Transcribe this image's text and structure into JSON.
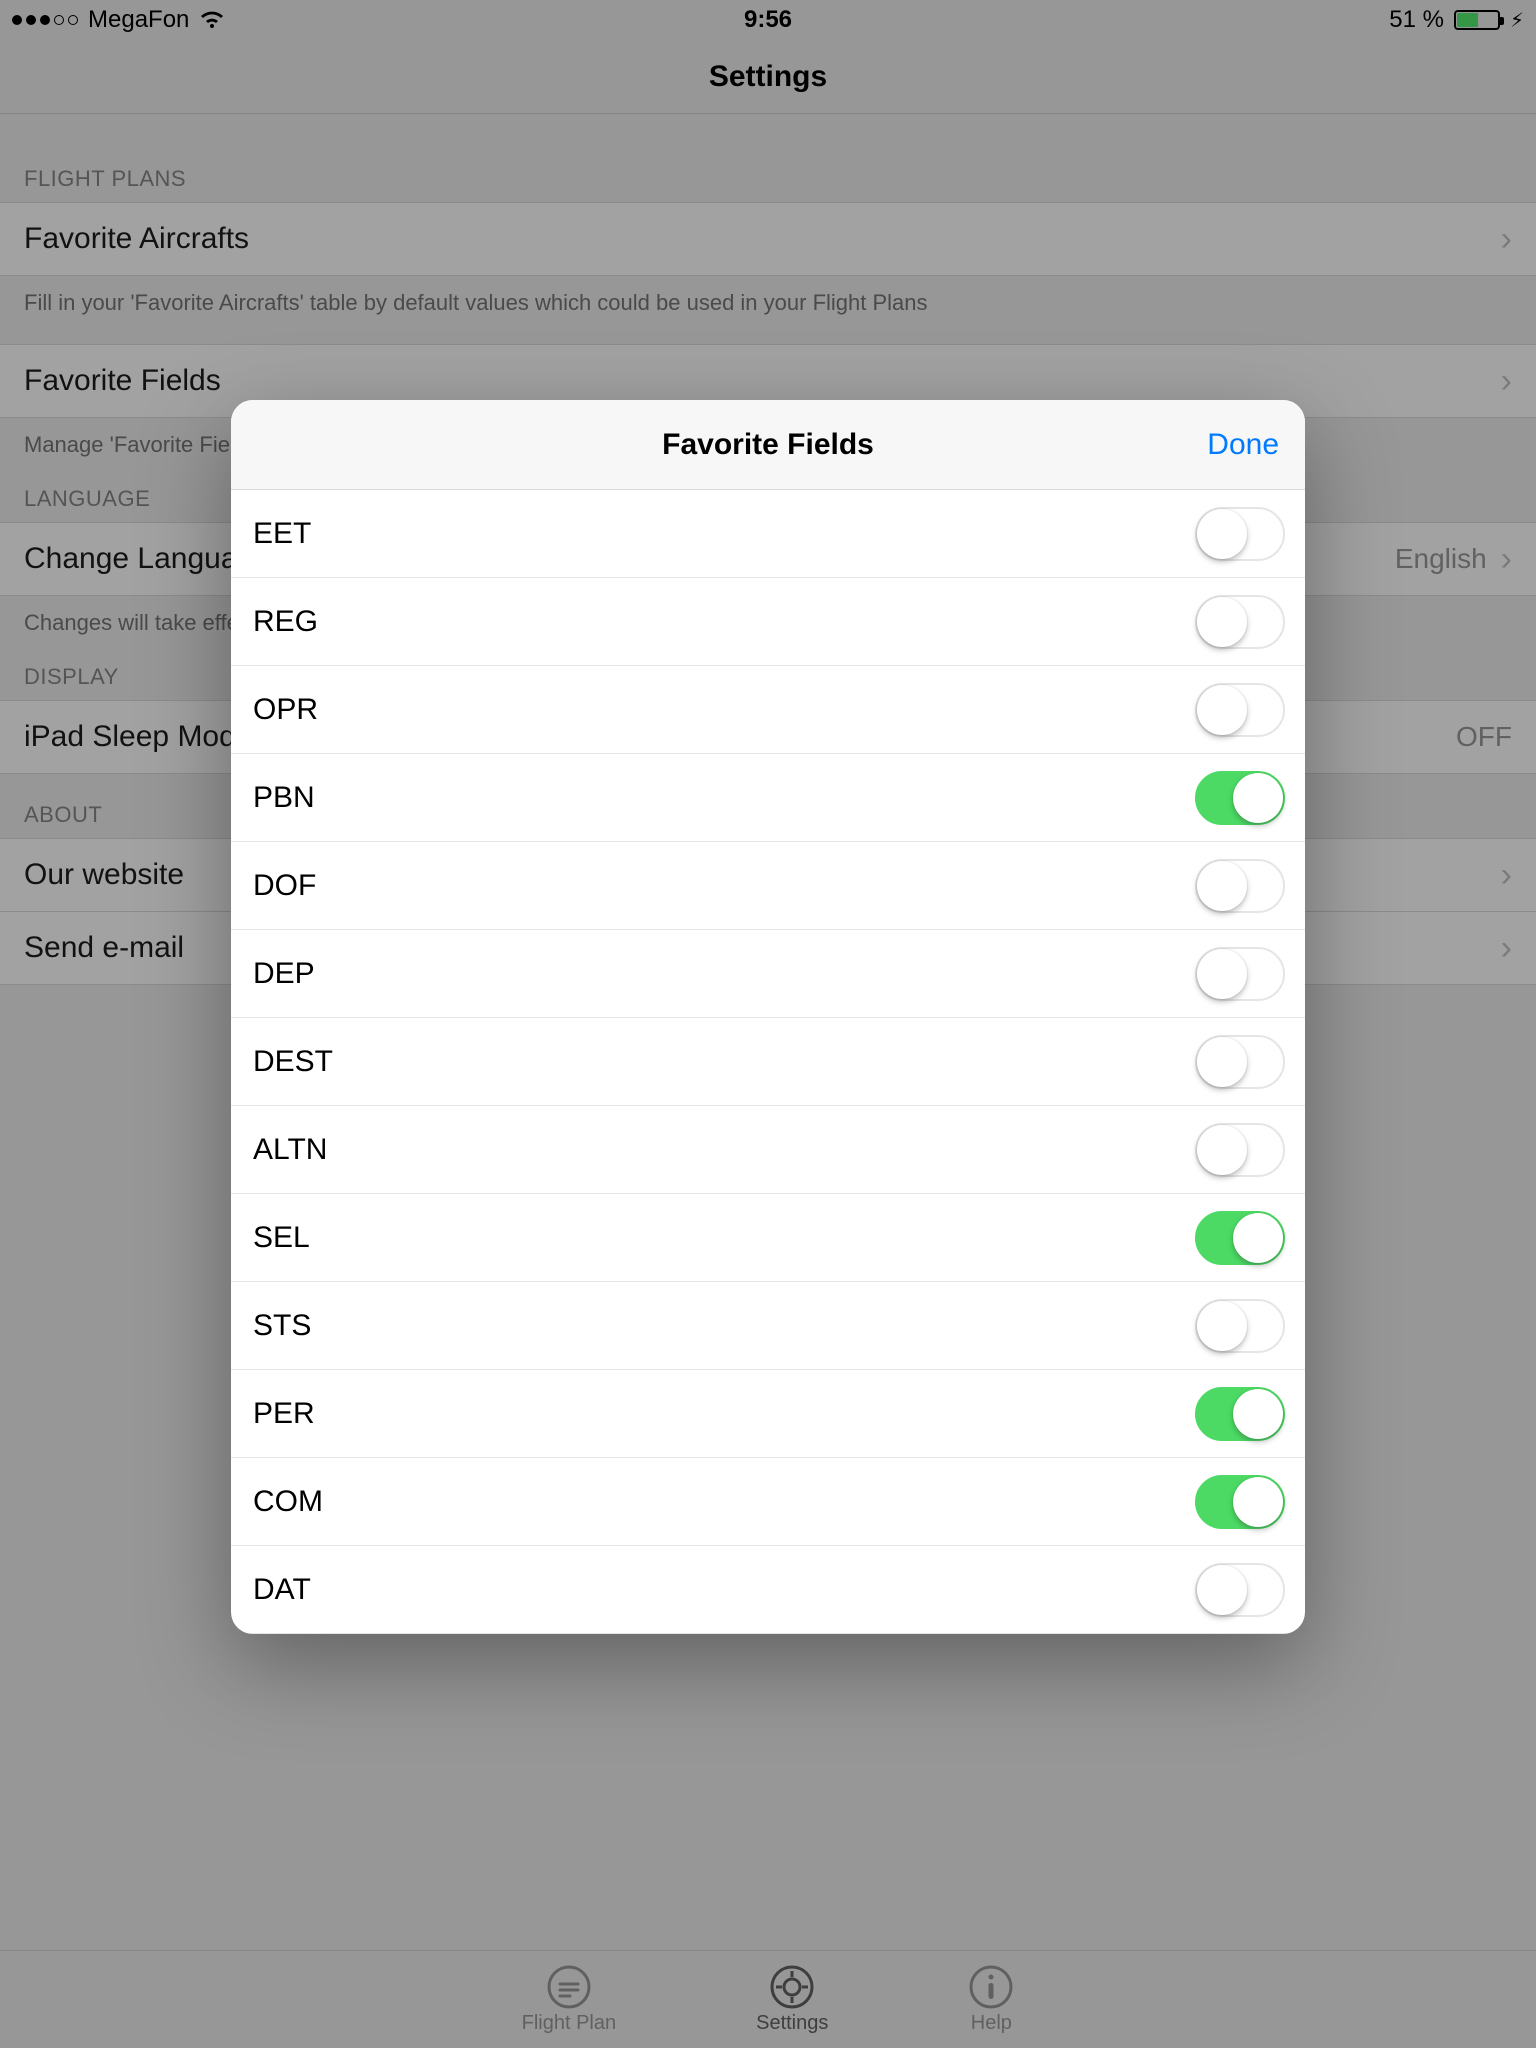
{
  "statusbar": {
    "carrier": "MegaFon",
    "time": "9:56",
    "battery_text": "51 %"
  },
  "nav": {
    "title": "Settings"
  },
  "sections": {
    "flight_plans": {
      "header": "FLIGHT PLANS",
      "fav_aircrafts": {
        "title": "Favorite Aircrafts",
        "footer": "Fill in your 'Favorite Aircrafts' table by default values which could be used in your Flight Plans"
      },
      "fav_fields": {
        "title": "Favorite Fields",
        "footer": "Manage 'Favorite Fields'"
      }
    },
    "language": {
      "header": "LANGUAGE",
      "change_lang": {
        "title": "Change Language",
        "value": "English",
        "footer": "Changes will take effect"
      }
    },
    "display": {
      "header": "DISPLAY",
      "sleep": {
        "title": "iPad Sleep Mode",
        "value": "OFF"
      }
    },
    "about": {
      "header": "ABOUT",
      "website": {
        "title": "Our website"
      },
      "email": {
        "title": "Send e-mail"
      }
    }
  },
  "modal": {
    "title": "Favorite Fields",
    "done": "Done",
    "rows": [
      {
        "label": "EET",
        "on": false
      },
      {
        "label": "REG",
        "on": false
      },
      {
        "label": "OPR",
        "on": false
      },
      {
        "label": "PBN",
        "on": true
      },
      {
        "label": "DOF",
        "on": false
      },
      {
        "label": "DEP",
        "on": false
      },
      {
        "label": "DEST",
        "on": false
      },
      {
        "label": "ALTN",
        "on": false
      },
      {
        "label": "SEL",
        "on": true
      },
      {
        "label": "STS",
        "on": false
      },
      {
        "label": "PER",
        "on": true
      },
      {
        "label": "COM",
        "on": true
      },
      {
        "label": "DAT",
        "on": false
      }
    ]
  },
  "tabs": {
    "flight_plan": "Flight Plan",
    "settings": "Settings",
    "help": "Help"
  }
}
